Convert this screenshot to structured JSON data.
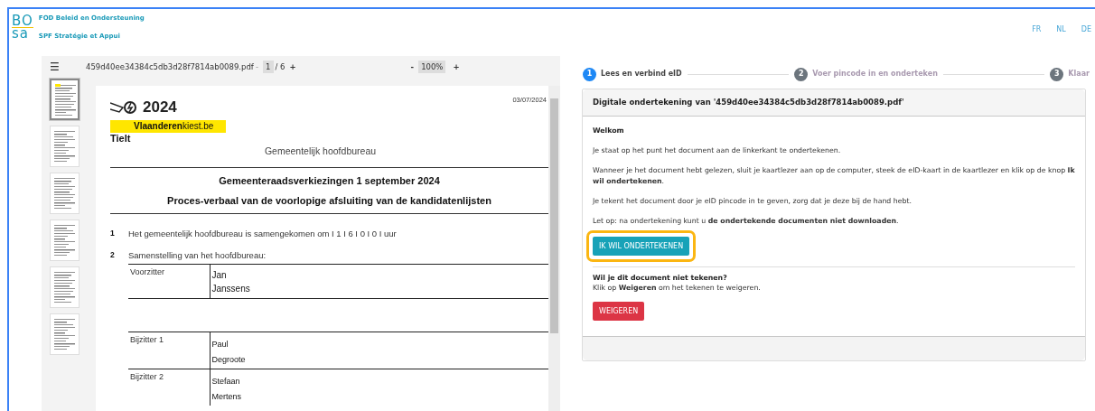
{
  "logo": {
    "mark_top": "BO",
    "mark_bottom": "sa",
    "line_1": "FOD Beleid en Ondersteuning",
    "line_2": "SPF Stratégie et Appui"
  },
  "languages": [
    {
      "label": "FR"
    },
    {
      "label": "NL"
    },
    {
      "label": "DE"
    }
  ],
  "viewer": {
    "menu": "☰",
    "filename": "459d40ee34384c5db3d28f7814ab0089.pdf",
    "page_prev": "-",
    "page": "1",
    "page_total": "/ 6",
    "page_next": "+",
    "zoom_out": "-",
    "zoom": "100%",
    "zoom_in": "+",
    "thumbnails": [
      {
        "selected": true
      },
      {
        "selected": false
      },
      {
        "selected": false
      },
      {
        "selected": false
      },
      {
        "selected": false
      },
      {
        "selected": false
      }
    ],
    "document": {
      "date": "03/07/2024",
      "banner_year": "2024",
      "banner_site": "**Vlaanderen**kiest.be",
      "municipality": "Tielt",
      "office": "Gemeentelijk hoofdbureau",
      "title_1": "Gemeenteraadsverkiezingen 1 september 2024",
      "title_2": "Proces-verbaal van de voorlopige afsluiting van de kandidatenlijsten",
      "items": [
        {
          "number": "1",
          "text": "Het gemeentelijk hoofdbureau is samengekomen om I 1 I 6 I 0 I 0 I uur"
        },
        {
          "number": "2",
          "text": "Samenstelling van het hoofdbureau:"
        }
      ],
      "members": [
        {
          "role": "Voorzitter",
          "first_name": "Jan",
          "last_name": "Janssens"
        },
        {
          "kind": "blank"
        },
        {
          "role": "Bijzitter 1",
          "first_name": "Paul",
          "last_name": "Degroote"
        },
        {
          "role": "Bijzitter 2",
          "first_name": "Stefaan",
          "last_name": "Mertens"
        }
      ]
    }
  },
  "steps": [
    {
      "number": "1",
      "label": "Lees en verbind eID",
      "selected": true
    },
    {
      "number": "2",
      "label": "Voer pincode in en onderteken",
      "selected": false
    },
    {
      "number": "3",
      "label": "Klaar",
      "selected": false
    }
  ],
  "card": {
    "header": "Digitale ondertekening van '459d40ee34384c5db3d28f7814ab0089.pdf'",
    "welcome": "Welkom",
    "paragraphs": [
      "Je staat op het punt het document aan de linkerkant te ondertekenen.",
      "Wanneer je het document hebt gelezen, sluit je kaartlezer aan op de computer, steek de eID-kaart in de kaartlezer en klik op de knop **Ik wil ondertekenen**.",
      "Je tekent het document door je eID pincode in te geven, zorg dat je deze bij de hand hebt.",
      "Let op: na ondertekening kunt u **de ondertekende documenten niet downloaden**."
    ],
    "sign_button": {
      "label": "IK WIL ONDERTEKENEN",
      "highlighted": true
    },
    "refuse_title": "Wil je dit document niet tekenen?",
    "refuse_text": "Klik op **Weigeren** om het tekenen te weigeren.",
    "refuse_button": {
      "label": "WEIGEREN"
    }
  }
}
